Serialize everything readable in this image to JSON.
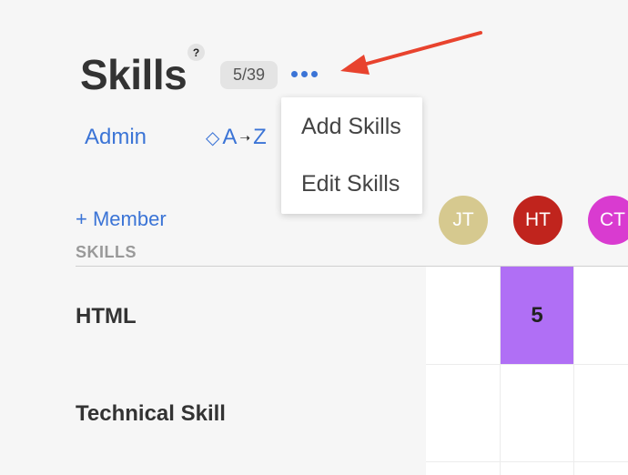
{
  "header": {
    "title": "Skills",
    "help_icon": "?",
    "count": "5/39",
    "more_icon": "more-horizontal-icon"
  },
  "toolbar": {
    "admin_label": "Admin",
    "sort": {
      "from": "A",
      "to": "Z"
    }
  },
  "dropdown": {
    "items": [
      {
        "label": "Add Skills"
      },
      {
        "label": "Edit Skills"
      }
    ]
  },
  "table": {
    "add_member_label": "+ Member",
    "skills_column_header": "SKILLS",
    "members": [
      {
        "initials": "JT",
        "color": "#d6c98f"
      },
      {
        "initials": "HT",
        "color": "#c0241d"
      },
      {
        "initials": "CT",
        "color": "#d93bd0"
      }
    ],
    "rows": [
      {
        "skill": "HTML",
        "cells": [
          "",
          "5",
          ""
        ]
      },
      {
        "skill": "Technical Skill",
        "cells": [
          "",
          "",
          ""
        ]
      }
    ]
  },
  "colors": {
    "accent": "#3b74d6",
    "annotation_arrow": "#e8432e",
    "skill_level_fill": "#b06ff5"
  }
}
